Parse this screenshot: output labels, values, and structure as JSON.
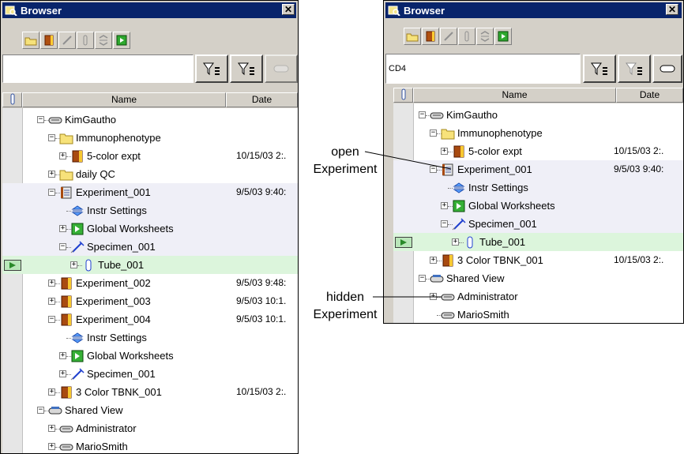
{
  "left": {
    "title": "Browser",
    "close_label": "✕",
    "search_value": "",
    "col_name": "Name",
    "col_date": "Date",
    "rows": [
      {
        "label": "KimGautho",
        "date": "",
        "icon": "user-icon",
        "toggle": "minus"
      },
      {
        "label": "Immunophenotype",
        "date": "",
        "icon": "folder-icon",
        "toggle": "minus"
      },
      {
        "label": "5-color expt",
        "date": "10/15/03 2:.",
        "icon": "experiment-icon",
        "toggle": "plus"
      },
      {
        "label": "daily QC",
        "date": "",
        "icon": "folder-icon",
        "toggle": "plus"
      },
      {
        "label": "Experiment_001",
        "date": "9/5/03 9:40:",
        "icon": "open-experiment-icon",
        "toggle": "minus"
      },
      {
        "label": "Instr Settings",
        "date": "",
        "icon": "instrument-settings-icon",
        "toggle": ""
      },
      {
        "label": "Global Worksheets",
        "date": "",
        "icon": "worksheet-icon",
        "toggle": "plus"
      },
      {
        "label": "Specimen_001",
        "date": "",
        "icon": "specimen-icon",
        "toggle": "minus"
      },
      {
        "label": "Tube_001",
        "date": "",
        "icon": "tube-icon",
        "toggle": "plus"
      },
      {
        "label": "Experiment_002",
        "date": "9/5/03 9:48:",
        "icon": "experiment-icon",
        "toggle": "plus"
      },
      {
        "label": "Experiment_003",
        "date": "9/5/03 10:1.",
        "icon": "experiment-icon",
        "toggle": "plus"
      },
      {
        "label": "Experiment_004",
        "date": "9/5/03 10:1.",
        "icon": "experiment-icon",
        "toggle": "minus"
      },
      {
        "label": "Instr Settings",
        "date": "",
        "icon": "instrument-settings-icon",
        "toggle": ""
      },
      {
        "label": "Global Worksheets",
        "date": "",
        "icon": "worksheet-icon",
        "toggle": "plus"
      },
      {
        "label": "Specimen_001",
        "date": "",
        "icon": "specimen-icon",
        "toggle": "plus"
      },
      {
        "label": "3 Color TBNK_001",
        "date": "10/15/03 2:.",
        "icon": "experiment-icon",
        "toggle": "plus"
      },
      {
        "label": "Shared View",
        "date": "",
        "icon": "shared-view-icon",
        "toggle": "minus"
      },
      {
        "label": "Administrator",
        "date": "",
        "icon": "user-icon",
        "toggle": "plus"
      },
      {
        "label": "MarioSmith",
        "date": "",
        "icon": "user-icon",
        "toggle": "plus"
      }
    ]
  },
  "right": {
    "title": "Browser",
    "close_label": "✕",
    "search_value": "CD4",
    "col_name": "Name",
    "col_date": "Date",
    "rows": [
      {
        "label": "KimGautho",
        "date": "",
        "icon": "user-icon",
        "toggle": "minus"
      },
      {
        "label": "Immunophenotype",
        "date": "",
        "icon": "folder-icon",
        "toggle": "minus"
      },
      {
        "label": "5-color expt",
        "date": "10/15/03 2:.",
        "icon": "experiment-icon",
        "toggle": "plus"
      },
      {
        "label": "Experiment_001",
        "date": "9/5/03 9:40:",
        "icon": "open-experiment-icon",
        "toggle": "minus"
      },
      {
        "label": "Instr Settings",
        "date": "",
        "icon": "instrument-settings-icon",
        "toggle": ""
      },
      {
        "label": "Global Worksheets",
        "date": "",
        "icon": "worksheet-icon",
        "toggle": "plus"
      },
      {
        "label": "Specimen_001",
        "date": "",
        "icon": "specimen-icon",
        "toggle": "minus"
      },
      {
        "label": "Tube_001",
        "date": "",
        "icon": "tube-icon",
        "toggle": "plus"
      },
      {
        "label": "3 Color TBNK_001",
        "date": "10/15/03 2:.",
        "icon": "experiment-icon",
        "toggle": "plus"
      },
      {
        "label": "Shared View",
        "date": "",
        "icon": "shared-view-icon",
        "toggle": "minus"
      },
      {
        "label": "Administrator",
        "date": "",
        "icon": "user-icon",
        "toggle": "plus"
      },
      {
        "label": "MarioSmith",
        "date": "",
        "icon": "user-icon",
        "toggle": ""
      }
    ]
  },
  "callouts": {
    "open_line1": "open",
    "open_line2": "Experiment",
    "hidden_line1": "hidden",
    "hidden_line2": "Experiment"
  }
}
